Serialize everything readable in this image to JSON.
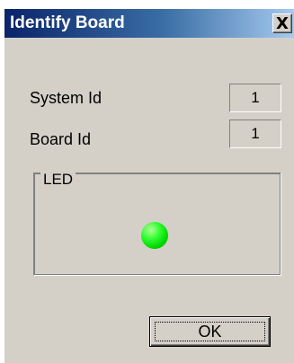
{
  "window": {
    "title": "Identify Board",
    "close_glyph": "X"
  },
  "fields": {
    "system_id_label": "System Id",
    "system_id_value": "1",
    "board_id_label": "Board Id",
    "board_id_value": "1"
  },
  "led_group": {
    "legend": "LED",
    "led_status_color": "#00e000",
    "led_icon": "led-indicator-icon"
  },
  "buttons": {
    "ok_label": "OK"
  }
}
